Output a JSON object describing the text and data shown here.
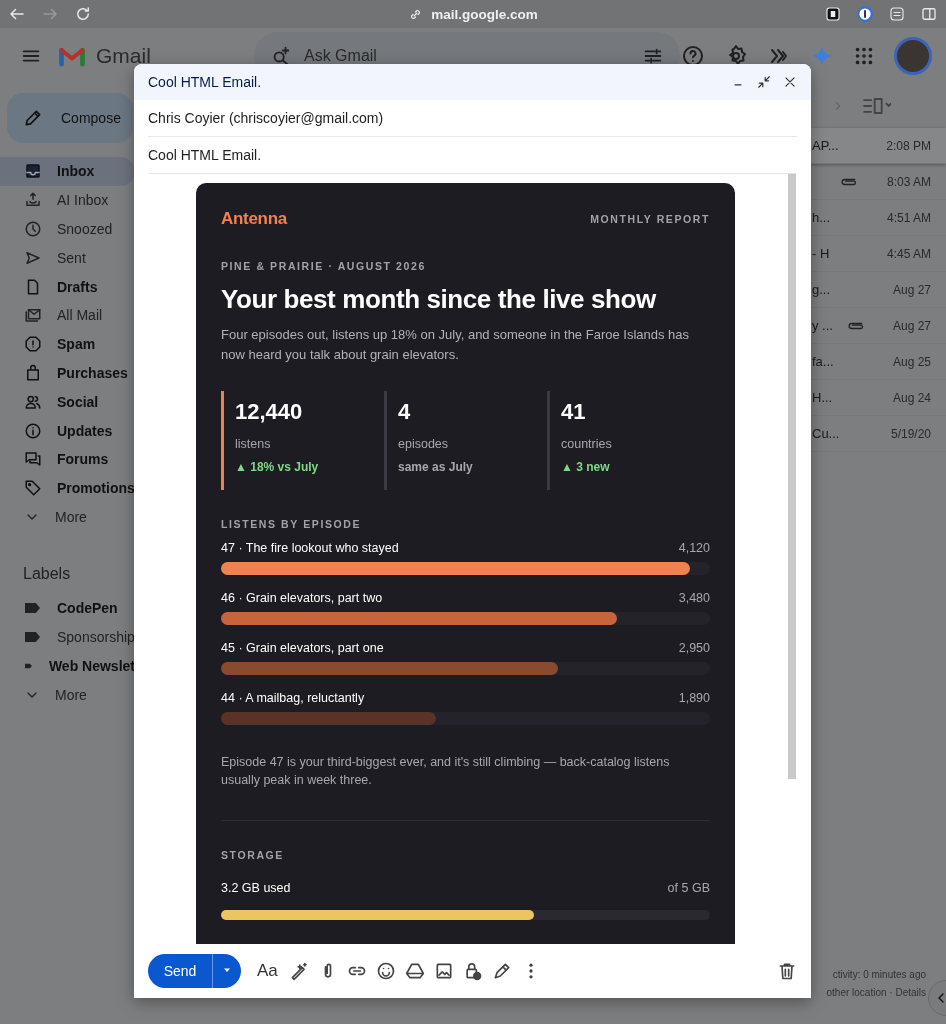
{
  "browser": {
    "url": "mail.google.com",
    "forward_disabled": true
  },
  "header": {
    "app_name": "Gmail",
    "search": {
      "placeholder": "Ask Gmail"
    }
  },
  "sidebar": {
    "compose": "Compose",
    "items": [
      {
        "label": "Inbox",
        "selected": true,
        "unread": true
      },
      {
        "label": "AI Inbox",
        "selected": false,
        "unread": false
      },
      {
        "label": "Snoozed",
        "selected": false,
        "unread": false
      },
      {
        "label": "Sent",
        "selected": false,
        "unread": false
      },
      {
        "label": "Drafts",
        "selected": false,
        "unread": true
      },
      {
        "label": "All Mail",
        "selected": false,
        "unread": false
      },
      {
        "label": "Spam",
        "selected": false,
        "unread": true
      },
      {
        "label": "Purchases",
        "selected": false,
        "unread": true
      },
      {
        "label": "Social",
        "selected": false,
        "unread": true
      },
      {
        "label": "Updates",
        "selected": false,
        "unread": true
      },
      {
        "label": "Forums",
        "selected": false,
        "unread": true
      },
      {
        "label": "Promotions",
        "selected": false,
        "unread": true
      }
    ],
    "more": "More",
    "labels_title": "Labels",
    "labels": [
      {
        "label": "CodePen",
        "unread": true
      },
      {
        "label": "Sponsorship",
        "unread": false
      },
      {
        "label": "Web Newslet",
        "unread": true
      }
    ],
    "labels_more": "More"
  },
  "mail_list": {
    "rows": [
      {
        "snippet": "AP...",
        "time": "2:08 PM",
        "attachment": false,
        "selected": true
      },
      {
        "snippet": "",
        "time": "8:03 AM",
        "attachment": true,
        "selected": false
      },
      {
        "snippet": "h...",
        "time": "4:51 AM",
        "attachment": false,
        "selected": false
      },
      {
        "snippet": "- H",
        "time": "4:45 AM",
        "attachment": false,
        "selected": false
      },
      {
        "snippet": "g...",
        "time": "Aug 27",
        "attachment": false,
        "selected": false
      },
      {
        "snippet": "y ...",
        "time": "Aug 27",
        "attachment": true,
        "selected": false
      },
      {
        "snippet": "fa...",
        "time": "Aug 25",
        "attachment": false,
        "selected": false
      },
      {
        "snippet": "H...",
        "time": "Aug 24",
        "attachment": false,
        "selected": false
      },
      {
        "snippet": "Cu...",
        "time": "5/19/20",
        "attachment": false,
        "selected": false
      }
    ]
  },
  "activity": {
    "line": "ctivity: 0 minutes ago",
    "location": "other location ·",
    "link": "Details"
  },
  "compose": {
    "title": "Cool HTML Email.",
    "to": "Chris Coyier (chriscoyier@gmail.com)",
    "subject": "Cool HTML Email.",
    "send": "Send",
    "format_button": "Aa",
    "email": {
      "brand": "Antenna",
      "report": "MONTHLY REPORT",
      "kicker": "PINE & PRAIRIE · AUGUST 2026",
      "headline": "Your best month since the live show",
      "intro": "Four episodes out, listens up 18% on July, and someone in the Faroe Islands has now heard you talk about grain elevators.",
      "stats": [
        {
          "value": "12,440",
          "label": "listens",
          "delta": "▲ 18% vs July",
          "kind": "up",
          "highlighted": true
        },
        {
          "value": "4",
          "label": "episodes",
          "delta": "same as July",
          "kind": "flat",
          "highlighted": false
        },
        {
          "value": "41",
          "label": "countries",
          "delta": "▲ 3 new",
          "kind": "up",
          "highlighted": false
        }
      ],
      "episodes_title": "LISTENS BY EPISODE",
      "episodes": [
        {
          "title": "47 · The fire lookout who stayed",
          "value": "4,120",
          "level": 0.96,
          "color": "#ef8250"
        },
        {
          "title": "46 · Grain elevators, part two",
          "value": "3,480",
          "level": 0.81,
          "color": "#c8643c"
        },
        {
          "title": "45 · Grain elevators, part one",
          "value": "2,950",
          "level": 0.69,
          "color": "#8a4a2d"
        },
        {
          "title": "44 · A mailbag, reluctantly",
          "value": "1,890",
          "level": 0.44,
          "color": "#5a3326"
        }
      ],
      "note": "Episode 47 is your third-biggest ever, and it's still climbing — back-catalog listens usually peak in week three.",
      "storage": {
        "title": "STORAGE",
        "used": "3.2 GB used",
        "total": "of 5 GB",
        "level": 0.64
      }
    }
  }
}
